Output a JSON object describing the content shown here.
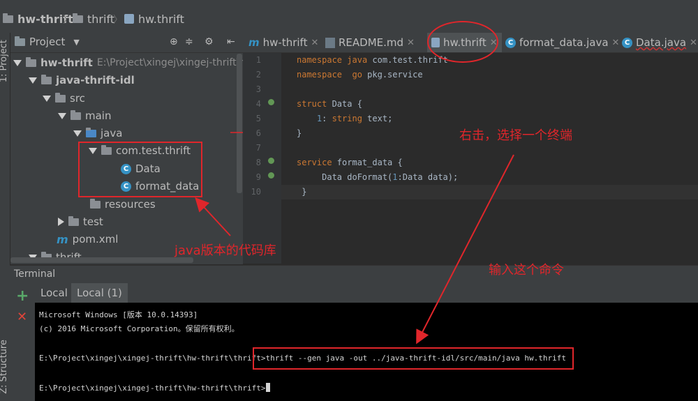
{
  "breadcrumb": {
    "project": "hw-thrift",
    "folder": "thrift",
    "file": "hw.thrift"
  },
  "left_strip": {
    "project_label": "1: Project",
    "structure_label": "Z: Structure"
  },
  "project_panel": {
    "title": "Project",
    "tree": {
      "root_name": "hw-thrift",
      "root_path": "E:\\Project\\xingej\\xingej-thrift\\hw",
      "module": "java-thrift-idl",
      "src": "src",
      "main": "main",
      "java": "java",
      "package": "com.test.thrift",
      "class_data": "Data",
      "class_format": "format_data",
      "resources": "resources",
      "test": "test",
      "pom": "pom.xml",
      "thrift": "thrift"
    }
  },
  "editor": {
    "tabs": [
      {
        "label": "hw-thrift"
      },
      {
        "label": "README.md"
      },
      {
        "label": "hw.thrift"
      },
      {
        "label": "format_data.java"
      },
      {
        "label": "Data.java"
      }
    ],
    "line_numbers": [
      "1",
      "2",
      "3",
      "4",
      "5",
      "6",
      "7",
      "8",
      "9",
      "10"
    ],
    "code": {
      "l1_kw": "namespace",
      "l1_lang": "java",
      "l1_rest": " com.test.thrift",
      "l2_kw": "namespace",
      "l2_lang": "go",
      "l2_rest": " pkg.service",
      "l4_kw": "struct",
      "l4_rest": " Data {",
      "l5_num": "1",
      "l5_kw": "string",
      "l5_rest": " text;",
      "l6": "}",
      "l8_kw": "service",
      "l8_rest": " format_data {",
      "l9_a": "Data doFormat(",
      "l9_num": "1",
      "l9_b": ":Data data);",
      "l10": "}"
    }
  },
  "terminal": {
    "title": "Terminal",
    "tabs": [
      "Local",
      "Local (1)"
    ],
    "lines": [
      "Microsoft Windows [版本 10.0.14393]",
      "(c) 2016 Microsoft Corporation。保留所有权利。",
      "E:\\Project\\xingej\\xingej-thrift\\hw-thrift\\thrift>thrift --gen java -out ../java-thrift-idl/src/main/java hw.thrift",
      "E:\\Project\\xingej\\xingej-thrift\\hw-thrift\\thrift>"
    ]
  },
  "annotations": {
    "right_click": "右击，选择一个终端",
    "java_repo": "java版本的代码库",
    "input_cmd": "输入这个命令"
  },
  "colors": {
    "annotation_red": "#e0262b",
    "keyword": "#cc7832",
    "number": "#6897bb"
  }
}
